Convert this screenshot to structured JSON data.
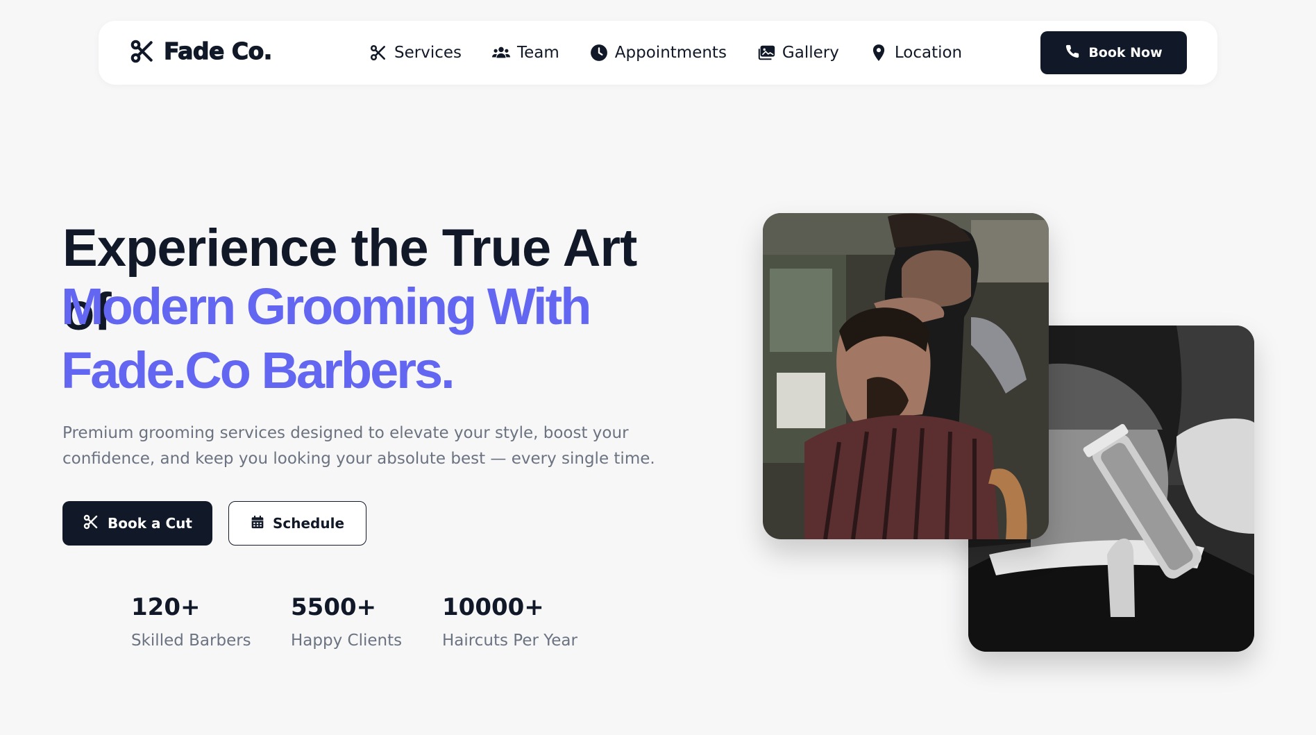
{
  "nav": {
    "brand": "Fade Co.",
    "items": [
      {
        "label": "Services",
        "icon": "scissors-icon"
      },
      {
        "label": "Team",
        "icon": "users-icon"
      },
      {
        "label": "Appointments",
        "icon": "clock-icon"
      },
      {
        "label": "Gallery",
        "icon": "images-icon"
      },
      {
        "label": "Location",
        "icon": "map-pin-icon"
      }
    ],
    "cta": "Book Now"
  },
  "hero": {
    "title": "Experience the True Art of",
    "accent": "Modern Grooming With Fade.Co Barbers.",
    "description": "Premium grooming services designed to elevate your style, boost your confidence, and keep you looking your absolute best — every single time.",
    "primary_button": "Book a Cut",
    "secondary_button": "Schedule"
  },
  "stats": [
    {
      "value": "120+",
      "label": "Skilled Barbers"
    },
    {
      "value": "5500+",
      "label": "Happy Clients"
    },
    {
      "value": "10000+",
      "label": "Haircuts Per Year"
    }
  ],
  "colors": {
    "accent": "#6366f1",
    "dark": "#111827",
    "muted": "#6b7280",
    "background": "#f7f7f8"
  }
}
